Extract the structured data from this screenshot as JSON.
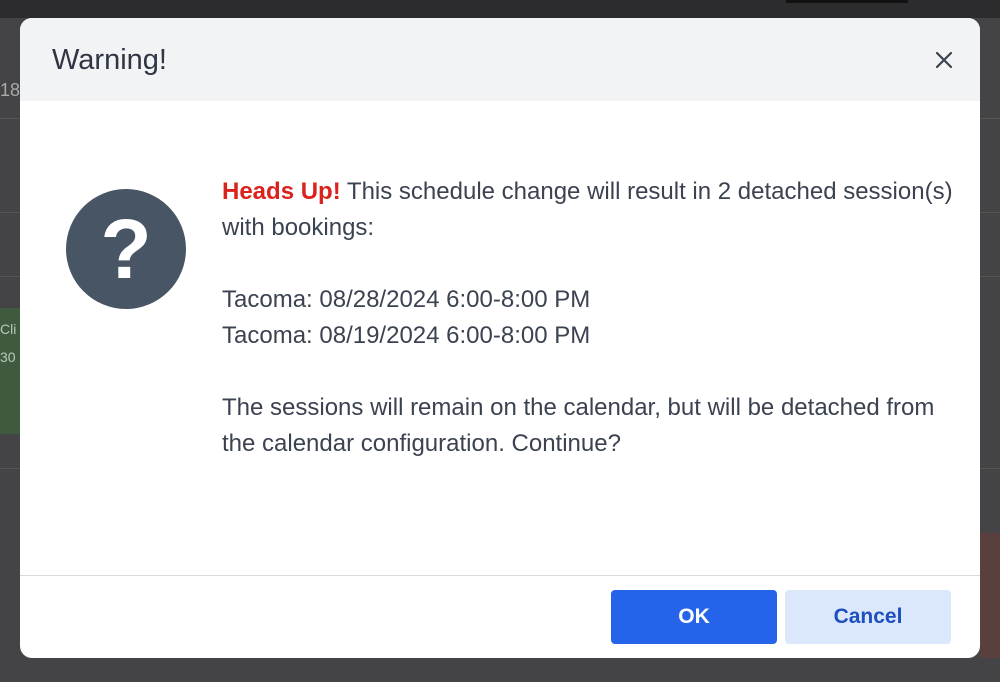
{
  "background": {
    "row_number_fragment": "18",
    "green_fragment_line1": "Cli",
    "green_fragment_line2": "30"
  },
  "modal": {
    "title": "Warning!",
    "close_icon": "close-icon",
    "icon": "question-circle-icon",
    "icon_glyph": "?",
    "heads_up": "Heads Up!",
    "intro": " This schedule change will result in 2 detached session(s) with bookings:",
    "sessions": [
      "Tacoma: 08/28/2024 6:00-8:00 PM",
      "Tacoma: 08/19/2024 6:00-8:00 PM"
    ],
    "closing": "The sessions will remain on the calendar, but will be detached from the calendar configuration. Continue?",
    "ok_label": "OK",
    "cancel_label": "Cancel"
  },
  "colors": {
    "ok_button": "#2563eb",
    "cancel_button": "#dbe8fc",
    "heads_up": "#d9231c",
    "icon_circle": "#485565"
  }
}
